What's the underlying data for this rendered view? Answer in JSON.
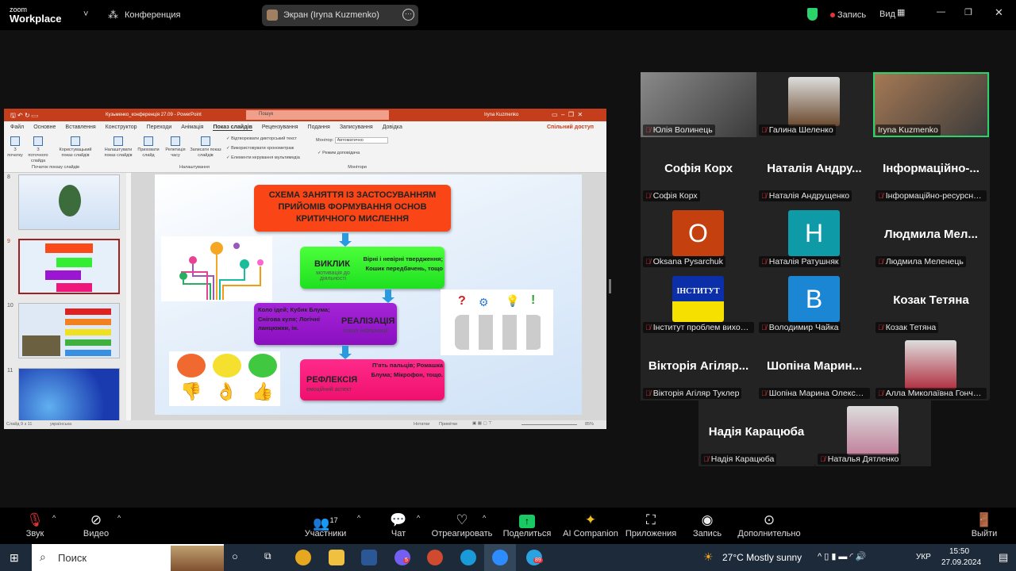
{
  "zoom": {
    "logo_small": "zoom",
    "logo_big": "Workplace",
    "meeting_label": "Конференция",
    "share_label": "Экран (Iryna Kuzmenko)",
    "record_label": "Запись",
    "view_label": "Вид",
    "colors": {
      "accent_green": "#2bd36b",
      "record_red": "#e0353a",
      "share_green": "#18c964"
    }
  },
  "ppt": {
    "title": "Кузьменко_конференція 27.09  -  PowerPoint",
    "search": "Пошук",
    "user": "Iryna Kuzmenko",
    "share": "Спільний доступ",
    "tabs": [
      "Файл",
      "Основне",
      "Вставлення",
      "Конструктор",
      "Переходи",
      "Анімація",
      "Показ слайдів",
      "Рецензування",
      "Подання",
      "Записування",
      "Довідка"
    ],
    "active_tab": "Показ слайдів",
    "ribbon": {
      "b1": "З початку",
      "b2": "З поточного слайда",
      "b3": "Користувацький показ слайдів",
      "g1": "Початок показу слайдів",
      "b4": "Налаштувати показ слайдів",
      "b5": "Приховати слайд",
      "b6": "Репетиція часу",
      "b7": "Записати показ слайдів",
      "c1": "Відтворювати дикторський текст",
      "c2": "Використовувати хронометраж",
      "c3": "Елементи керування мультимедіа",
      "g2": "Налаштування",
      "monitor_label": "Монітор:",
      "monitor_value": "Автоматично",
      "presenter": "Режим доповідача",
      "g3": "Монітори"
    },
    "thumb_numbers": [
      "8",
      "9",
      "10",
      "11"
    ],
    "status": {
      "slide": "Слайд 9 з 11",
      "lang": "українська",
      "notes": "Нотатки",
      "comments": "Примітки",
      "zoom": "85%"
    },
    "slide": {
      "title": "СХЕМА ЗАНЯТТЯ ІЗ ЗАСТОСУВАННЯМ ПРИЙОМІВ ФОРМУВАННЯ ОСНОВ КРИТИЧНОГО МИСЛЕННЯ",
      "s1": {
        "head": "ВИКЛИК",
        "sub": "мотивація до діяльності",
        "right": "Вірні і невірні твердження; Кошик передбачень, тощо"
      },
      "s2": {
        "left": "Коло ідей; Кубик Блума; Снігова куля; Логічні ланцюжки, ін.",
        "head": "РЕАЛІЗАЦІЯ",
        "sub": "пошук інформації"
      },
      "s3": {
        "head": "РЕФЛЕКСІЯ",
        "sub": "емоційний аспект",
        "right": "П'ять пальців; Ромашка Блума; Мікрофон, тощо."
      }
    }
  },
  "gallery": [
    {
      "big": "",
      "name": "Юлія Волинець",
      "kind": "video",
      "color": "#8a8a8a"
    },
    {
      "big": "",
      "name": "Галина Шеленко",
      "kind": "photo",
      "color": "#6b4a2e"
    },
    {
      "big": "",
      "name": "Iryna Kuzmenko",
      "kind": "video",
      "color": "#a77a55",
      "active": true,
      "muted": false
    },
    {
      "big": "Софія Корх",
      "name": "Софія Корх",
      "kind": "text"
    },
    {
      "big": "Наталія Андру...",
      "name": "Наталія Андрущенко",
      "kind": "text"
    },
    {
      "big": "Інформаційно-...",
      "name": "Інформаційно-ресурсни...",
      "kind": "text"
    },
    {
      "big": "O",
      "name": "Oksana Pysarchuk",
      "kind": "avatar",
      "color": "#c4410f"
    },
    {
      "big": "H",
      "name": "Наталія Ратушняк",
      "kind": "avatar",
      "color": "#0e9aa7"
    },
    {
      "big": "Людмила Мел...",
      "name": "Людмила Меленець",
      "kind": "text"
    },
    {
      "big": "ІНСТИТУТ",
      "name": "Інститут проблем вихова...",
      "kind": "logo",
      "color": "#0a2fa8"
    },
    {
      "big": "B",
      "name": "Володимир Чайка",
      "kind": "avatar",
      "color": "#1b86d4"
    },
    {
      "big": "Козак Тетяна",
      "name": "Козак Тетяна",
      "kind": "text"
    },
    {
      "big": "Вікторія Агіляр...",
      "name": "Вікторія Агіляр Туклер",
      "kind": "text"
    },
    {
      "big": "Шопіна Марин...",
      "name": "Шопіна Марина Олексан...",
      "kind": "text"
    },
    {
      "big": "",
      "name": "Алла Миколаївна Гончар...",
      "kind": "photo",
      "color": "#b03040"
    },
    {
      "big": "Надія Карацюба",
      "name": "Надія Карацюба",
      "kind": "text"
    },
    {
      "big": "",
      "name": "Наталья Дятленко",
      "kind": "photo",
      "color": "#c0809a"
    }
  ],
  "toolbar": {
    "audio": "Звук",
    "video": "Видео",
    "participants": "Участники",
    "participants_count": "17",
    "chat": "Чат",
    "react": "Отреагировать",
    "share": "Поделиться",
    "ai": "AI Companion",
    "apps": "Приложения",
    "record": "Запись",
    "more": "Дополнительно",
    "leave": "Выйти"
  },
  "taskbar": {
    "search": "Поиск",
    "weather": "27°C  Mostly sunny",
    "lang": "УКР",
    "time": "15:50",
    "date": "27.09.2024",
    "viber_badge": "5",
    "telegram_badge": "89"
  }
}
